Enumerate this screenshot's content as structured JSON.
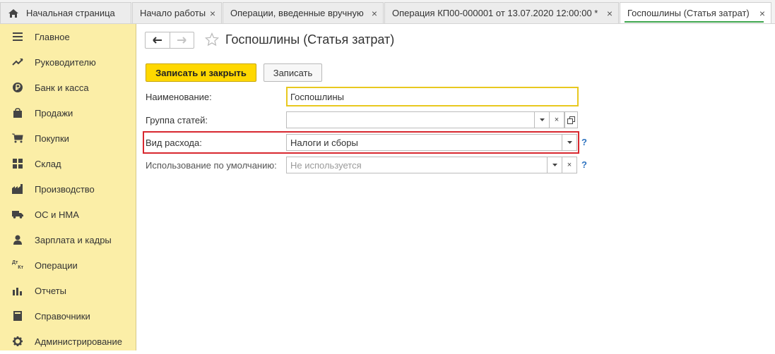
{
  "tabs": [
    {
      "label": "Начальная страница",
      "icon": "home-icon",
      "closable": false,
      "active": false
    },
    {
      "label": "Начало работы",
      "closable": true,
      "active": false
    },
    {
      "label": "Операции, введенные вручную",
      "closable": true,
      "active": false
    },
    {
      "label": "Операция КП00-000001 от 13.07.2020 12:00:00 *",
      "closable": true,
      "active": false
    },
    {
      "label": "Госпошлины (Статья затрат)",
      "closable": true,
      "active": true
    }
  ],
  "tab_close_glyph": "×",
  "sidebar": {
    "items": [
      {
        "label": "Главное",
        "icon": "menu-icon"
      },
      {
        "label": "Руководителю",
        "icon": "trend-icon"
      },
      {
        "label": "Банк и касса",
        "icon": "ruble-icon"
      },
      {
        "label": "Продажи",
        "icon": "bag-icon"
      },
      {
        "label": "Покупки",
        "icon": "cart-icon"
      },
      {
        "label": "Склад",
        "icon": "grid-icon"
      },
      {
        "label": "Производство",
        "icon": "factory-icon"
      },
      {
        "label": "ОС и НМА",
        "icon": "truck-icon"
      },
      {
        "label": "Зарплата и кадры",
        "icon": "person-icon"
      },
      {
        "label": "Операции",
        "icon": "dt-kt-icon"
      },
      {
        "label": "Отчеты",
        "icon": "bar-chart-icon"
      },
      {
        "label": "Справочники",
        "icon": "book-icon"
      },
      {
        "label": "Администрирование",
        "icon": "gear-icon"
      }
    ],
    "dt_kt_text": {
      "top": "Дт",
      "bottom": "Кт"
    }
  },
  "page": {
    "title": "Госпошлины (Статья затрат)"
  },
  "toolbar": {
    "save_close_label": "Записать и закрыть",
    "save_label": "Записать"
  },
  "form": {
    "name": {
      "label": "Наименование:",
      "value": "Госпошлины"
    },
    "group": {
      "label": "Группа статей:",
      "value": ""
    },
    "expense_type": {
      "label": "Вид расхода:",
      "value": "Налоги и сборы"
    },
    "default_usage": {
      "label": "Использование по умолчанию:",
      "placeholder": "Не используется"
    },
    "help_glyph": "?",
    "clear_glyph": "×"
  },
  "colors": {
    "sidebar_bg": "#fbeea7",
    "primary_button": "#ffd800",
    "highlight": "#d8282f",
    "active_tab_underline": "#3ea54d",
    "help": "#2f74c0"
  }
}
